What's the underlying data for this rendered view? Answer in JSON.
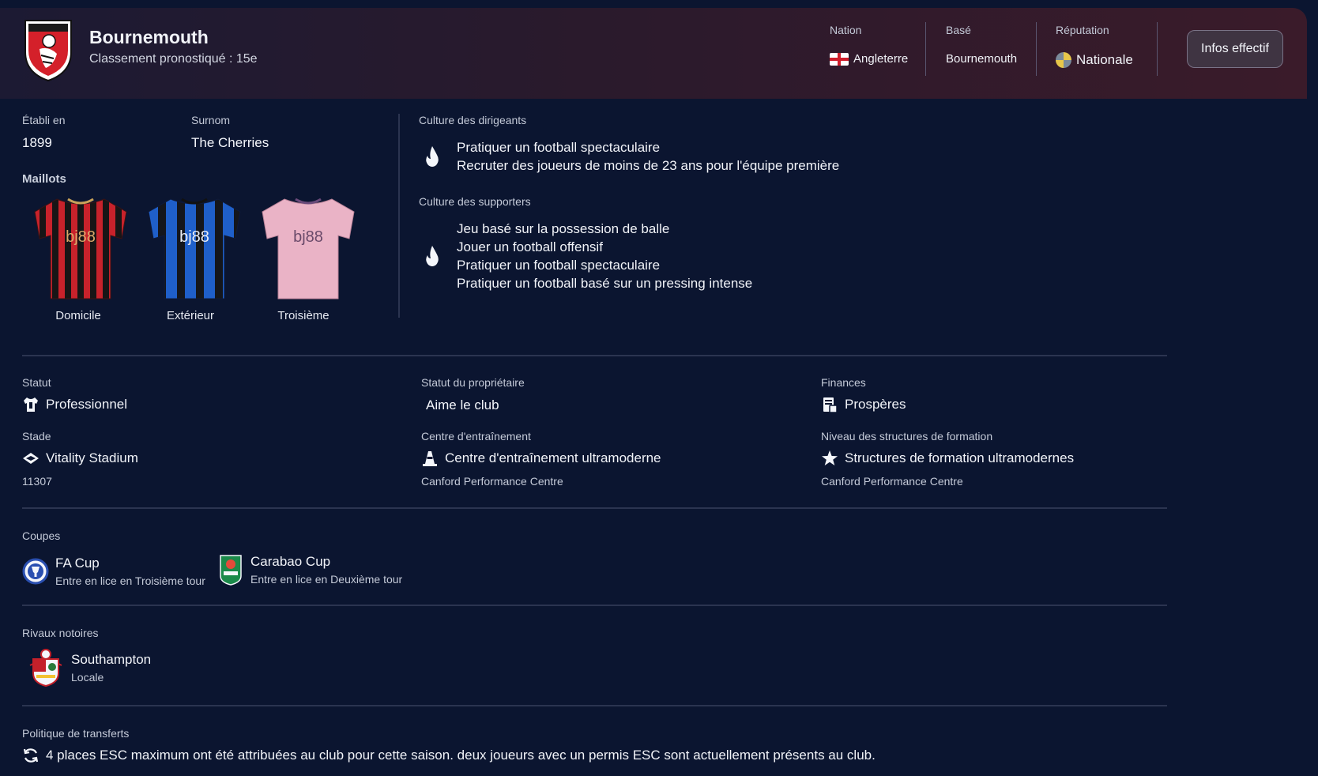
{
  "header": {
    "club_name": "Bournemouth",
    "subtitle": "Classement pronostiqué : 15e",
    "nation_label": "Nation",
    "nation_value": "Angleterre",
    "based_label": "Basé",
    "based_value": "Bournemouth",
    "reputation_label": "Réputation",
    "reputation_value": "Nationale",
    "squad_button": "Infos effectif"
  },
  "info": {
    "founded_label": "Établi en",
    "founded_value": "1899",
    "nickname_label": "Surnom",
    "nickname_value": "The Cherries",
    "kits_label": "Maillots",
    "kits": [
      {
        "label": "Domicile",
        "sponsor": "bj88",
        "colors": [
          "#c8222b",
          "#181516"
        ]
      },
      {
        "label": "Extérieur",
        "sponsor": "bj88",
        "colors": [
          "#1f5fc9",
          "#14161c"
        ]
      },
      {
        "label": "Troisième",
        "sponsor": "bj88",
        "colors": [
          "#eab3c6",
          "#eab3c6"
        ]
      }
    ]
  },
  "culture": {
    "board_label": "Culture des dirigeants",
    "board_items": [
      "Pratiquer un football spectaculaire",
      "Recruter des joueurs de moins de 23 ans pour l'équipe première"
    ],
    "supporters_label": "Culture des supporters",
    "supporters_items": [
      "Jeu basé sur la possession de balle",
      "Jouer un football offensif",
      "Pratiquer un football spectaculaire",
      "Pratiquer un football basé sur un pressing intense"
    ]
  },
  "details": {
    "status_label": "Statut",
    "status_value": "Professionnel",
    "owner_label": "Statut du propriétaire",
    "owner_value": "Aime le club",
    "finances_label": "Finances",
    "finances_value": "Prospères",
    "stadium_label": "Stade",
    "stadium_value": "Vitality Stadium",
    "stadium_capacity": "11307",
    "training_label": "Centre d'entraînement",
    "training_value": "Centre d'entraînement ultramoderne",
    "training_name": "Canford Performance Centre",
    "youth_label": "Niveau des structures de formation",
    "youth_value": "Structures de formation ultramodernes",
    "youth_name": "Canford Performance Centre"
  },
  "cups": {
    "label": "Coupes",
    "items": [
      {
        "name": "FA Cup",
        "entry": "Entre en lice en Troisième tour"
      },
      {
        "name": "Carabao Cup",
        "entry": "Entre en lice en Deuxième tour"
      }
    ]
  },
  "rivals": {
    "label": "Rivaux notoires",
    "items": [
      {
        "name": "Southampton",
        "type": "Locale"
      }
    ]
  },
  "transfers": {
    "label": "Politique de transferts",
    "text": "4 places ESC maximum ont été attribuées au club pour cette saison. deux joueurs avec un permis ESC sont actuellement présents au club."
  },
  "icons": {
    "crest": "bournemouth-crest-icon",
    "flag": "england-flag-icon",
    "reputation": "reputation-globe-icon",
    "culture": "flame-icon",
    "status": "shirt-icon",
    "stadium": "stadium-icon",
    "training": "cone-icon",
    "finances": "ledger-icon",
    "youth": "star-icon",
    "fa_cup": "fa-cup-badge-icon",
    "carabao": "carabao-cup-badge-icon",
    "rival": "southampton-crest-icon",
    "transfers": "refresh-icon"
  },
  "colors": {
    "background": "#0b1530",
    "header_start": "#1c1a33",
    "header_end": "#3a1b2a",
    "divider": "#2b3450"
  }
}
